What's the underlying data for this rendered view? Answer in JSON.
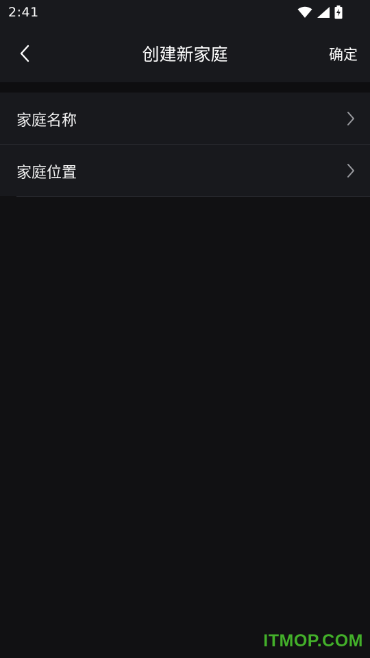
{
  "status_bar": {
    "time": "2:41",
    "icons": [
      "wifi-icon",
      "signal-icon",
      "battery-charging-icon"
    ]
  },
  "header": {
    "back_icon": "chevron-left-icon",
    "title": "创建新家庭",
    "confirm_label": "确定"
  },
  "list": {
    "items": [
      {
        "label": "家庭名称",
        "icon": "chevron-right-icon"
      },
      {
        "label": "家庭位置",
        "icon": "chevron-right-icon"
      }
    ]
  },
  "watermark": {
    "text": "ITMOP.COM",
    "color": "#43b02a"
  },
  "colors": {
    "background": "#111113",
    "surface": "#18191d",
    "divider": "#2a2b30",
    "text": "#f2f2f2"
  }
}
